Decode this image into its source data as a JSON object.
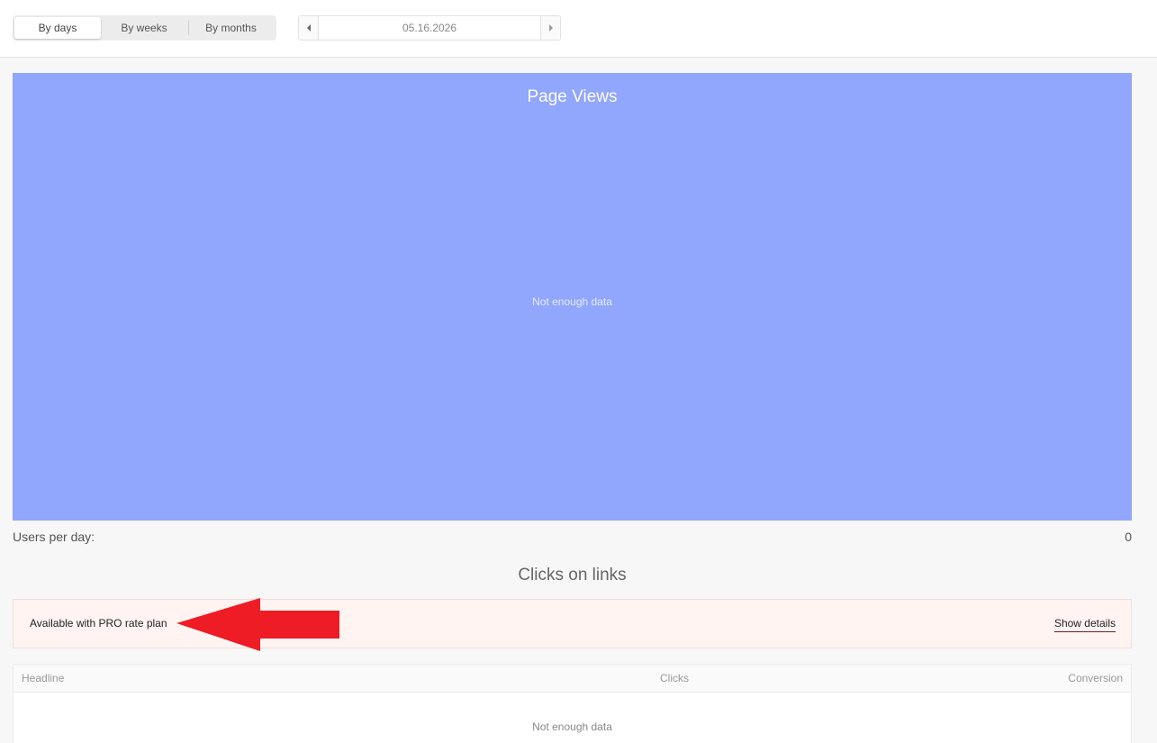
{
  "period_tabs": [
    {
      "label": "By days",
      "active": true
    },
    {
      "label": "By weeks",
      "active": false
    },
    {
      "label": "By months",
      "active": false
    }
  ],
  "date_picker": {
    "value": "05.16.2026"
  },
  "chart": {
    "title": "Page Views",
    "empty_message": "Not enough data",
    "background_color": "#91a6fd"
  },
  "users_per_day": {
    "label": "Users per day:",
    "value": "0"
  },
  "clicks_section": {
    "title": "Clicks on links",
    "pro_notice": "Available with PRO rate plan",
    "show_details_label": "Show details",
    "arrow_color": "#ee1c24",
    "table": {
      "columns": [
        "Headline",
        "Clicks",
        "Conversion"
      ],
      "empty_message": "Not enough data"
    }
  }
}
